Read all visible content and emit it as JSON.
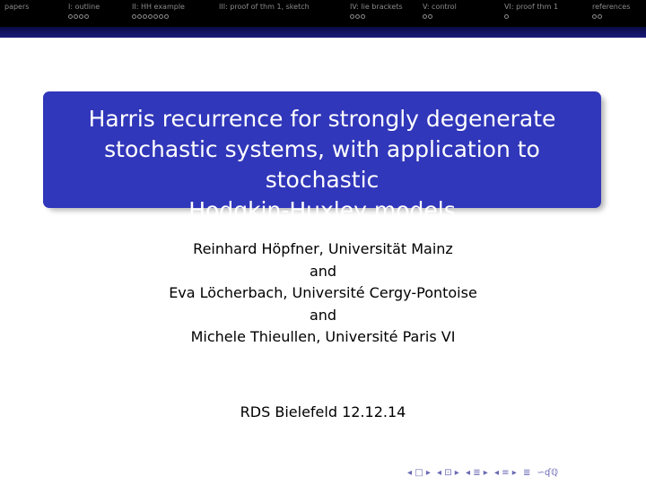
{
  "navigation": {
    "sections": [
      {
        "label": "papers",
        "dots": 0
      },
      {
        "label": "I: outline",
        "dots": 4
      },
      {
        "label": "II: HH example",
        "dots": 7
      },
      {
        "label": "III: proof of thm 1, sketch",
        "dots": 0
      },
      {
        "label": "IV: lie brackets",
        "dots": 3
      },
      {
        "label": "V: control",
        "dots": 2
      },
      {
        "label": "VI: proof thm 1",
        "dots": 1
      },
      {
        "label": "references",
        "dots": 2
      }
    ]
  },
  "title": {
    "line1": "Harris recurrence for strongly degenerate",
    "line2": "stochastic systems, with application to stochastic",
    "line3": "Hodgkin-Huxley models"
  },
  "authors": {
    "author1": "Reinhard Höpfner, Universität Mainz",
    "and1": "and",
    "author2": "Eva Löcherbach, Université Cergy-Pontoise",
    "and2": "and",
    "author3": "Michele Thieullen, Université Paris VI"
  },
  "date": "RDS Bielefeld 12.12.14",
  "bottom_nav": {
    "frame": "◂ □ ▸",
    "subsection": "◂ ⊡ ▸",
    "section": "◂ ≣ ▸",
    "subsubsection": "◂ ≡ ▸",
    "align": "≣",
    "search": "∽ʠℚ"
  },
  "colors": {
    "title_box": "#3137ba",
    "navbar": "#000000",
    "navband": "#1a1a7a",
    "nav_text": "#8a8a8a"
  }
}
